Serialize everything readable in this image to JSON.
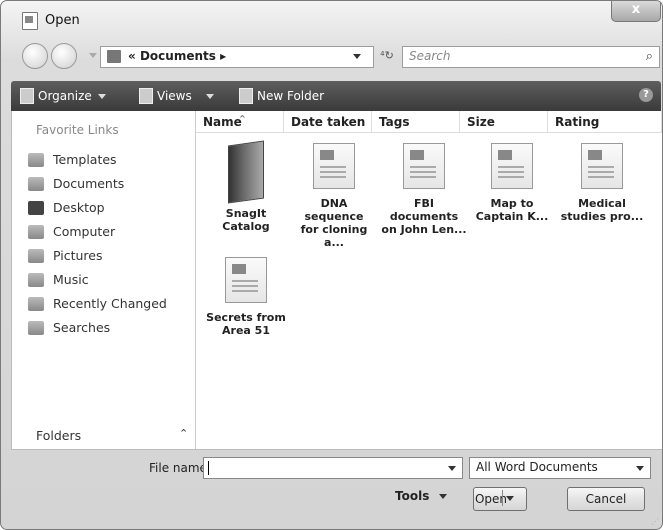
{
  "window": {
    "title": "Open",
    "close_glyph": "x"
  },
  "address": {
    "path_prefix": "«",
    "path": "Documents",
    "path_sep": "▸"
  },
  "search": {
    "placeholder": "Search",
    "icon": "magnifier-icon"
  },
  "toolbar": {
    "organize": "Organize",
    "views": "Views",
    "new_folder": "New Folder",
    "help": "?"
  },
  "sidebar": {
    "header": "Favorite Links",
    "items": [
      {
        "label": "Templates"
      },
      {
        "label": "Documents"
      },
      {
        "label": "Desktop"
      },
      {
        "label": "Computer"
      },
      {
        "label": "Pictures"
      },
      {
        "label": "Music"
      },
      {
        "label": "Recently Changed"
      },
      {
        "label": "Searches"
      }
    ],
    "folders": "Folders",
    "folders_arrow": "⌃"
  },
  "columns": [
    "Name",
    "Date taken",
    "Tags",
    "Size",
    "Rating"
  ],
  "files": [
    {
      "line1": "SnagIt Catalog",
      "line2": ""
    },
    {
      "line1": "DNA sequence",
      "line2": "for cloning a..."
    },
    {
      "line1": "FBI documents",
      "line2": "on John Len..."
    },
    {
      "line1": "Map to",
      "line2": "Captain K..."
    },
    {
      "line1": "Medical",
      "line2": "studies pro..."
    },
    {
      "line1": "Secrets from",
      "line2": "Area 51"
    }
  ],
  "footer": {
    "file_name_label": "File name:",
    "file_name_value": "",
    "file_type": "All Word Documents",
    "tools": "Tools",
    "open": "Open",
    "cancel": "Cancel"
  }
}
